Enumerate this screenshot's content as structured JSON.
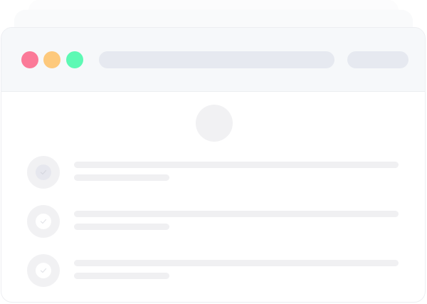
{
  "window": {
    "traffic_lights": {
      "close_color": "#fb7a98",
      "minimize_color": "#fdc97c",
      "maximize_color": "#5df9b4"
    },
    "address_bar": {
      "placeholder": ""
    },
    "action": {
      "label": ""
    }
  },
  "content": {
    "avatar": {
      "icon": "avatar-placeholder"
    },
    "tasks": [
      {
        "checked": true,
        "icon": "check-icon",
        "title": "",
        "subtitle": ""
      },
      {
        "checked": false,
        "icon": "check-icon",
        "title": "",
        "subtitle": ""
      },
      {
        "checked": false,
        "icon": "check-icon",
        "title": "",
        "subtitle": ""
      }
    ]
  }
}
